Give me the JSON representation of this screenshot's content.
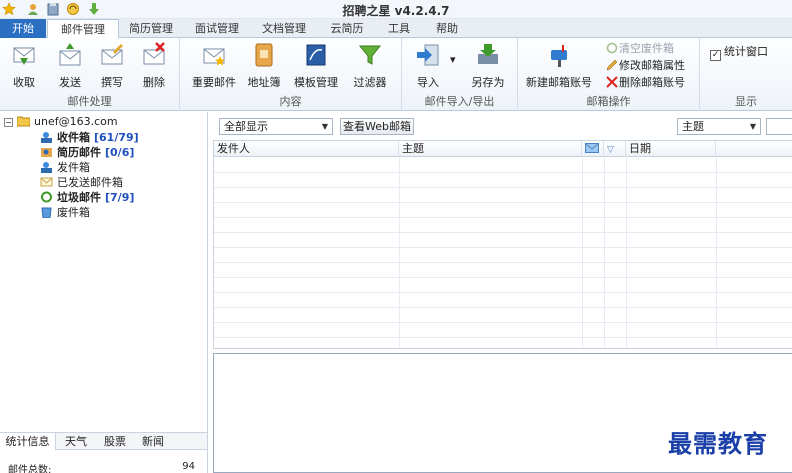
{
  "app": {
    "title": "招聘之星 v4.2.4.7"
  },
  "menu": {
    "start": "开始",
    "tabs": [
      "邮件管理",
      "简历管理",
      "面试管理",
      "文档管理",
      "云简历",
      "工具",
      "帮助"
    ]
  },
  "ribbon": {
    "mail_process": {
      "label": "邮件处理",
      "receive": "收取",
      "send": "发送",
      "compose": "撰写",
      "delete": "删除"
    },
    "content": {
      "label": "内容",
      "important": "重要邮件",
      "address_book": "地址簿",
      "templates": "模板管理",
      "filter": "过滤器"
    },
    "import_export": {
      "label": "邮件导入/导出",
      "import": "导入",
      "save_as": "另存为"
    },
    "mailbox_ops": {
      "label": "邮箱操作",
      "new_account": "新建邮箱账号",
      "empty_trash": "清空废件箱",
      "edit_props": "修改邮箱属性",
      "delete_account": "删除邮箱账号"
    },
    "display": {
      "label": "显示",
      "stats_window": "统计窗口"
    }
  },
  "tree": {
    "account": "unef@163.com",
    "folders": [
      {
        "name": "收件箱",
        "count": "[61/79]"
      },
      {
        "name": "简历邮件",
        "count": "[0/6]"
      },
      {
        "name": "发件箱",
        "count": ""
      },
      {
        "name": "已发送邮件箱",
        "count": ""
      },
      {
        "name": "垃圾邮件",
        "count": "[7/9]"
      },
      {
        "name": "废件箱",
        "count": ""
      }
    ]
  },
  "left_tabs": [
    "统计信息",
    "天气",
    "股票",
    "新闻"
  ],
  "stats": {
    "label": "邮件总数:",
    "value": "94"
  },
  "toolbar": {
    "filter_value": "全部显示",
    "web_button": "查看Web邮箱",
    "field_value": "主题"
  },
  "list_columns": {
    "sender": "发件人",
    "subject": "主题",
    "date": "日期"
  },
  "watermark": "最需教育",
  "colors": {
    "start_tab": "#2b6fc2",
    "count_blue": "#2050c0",
    "watermark": "#1a3fa8"
  }
}
